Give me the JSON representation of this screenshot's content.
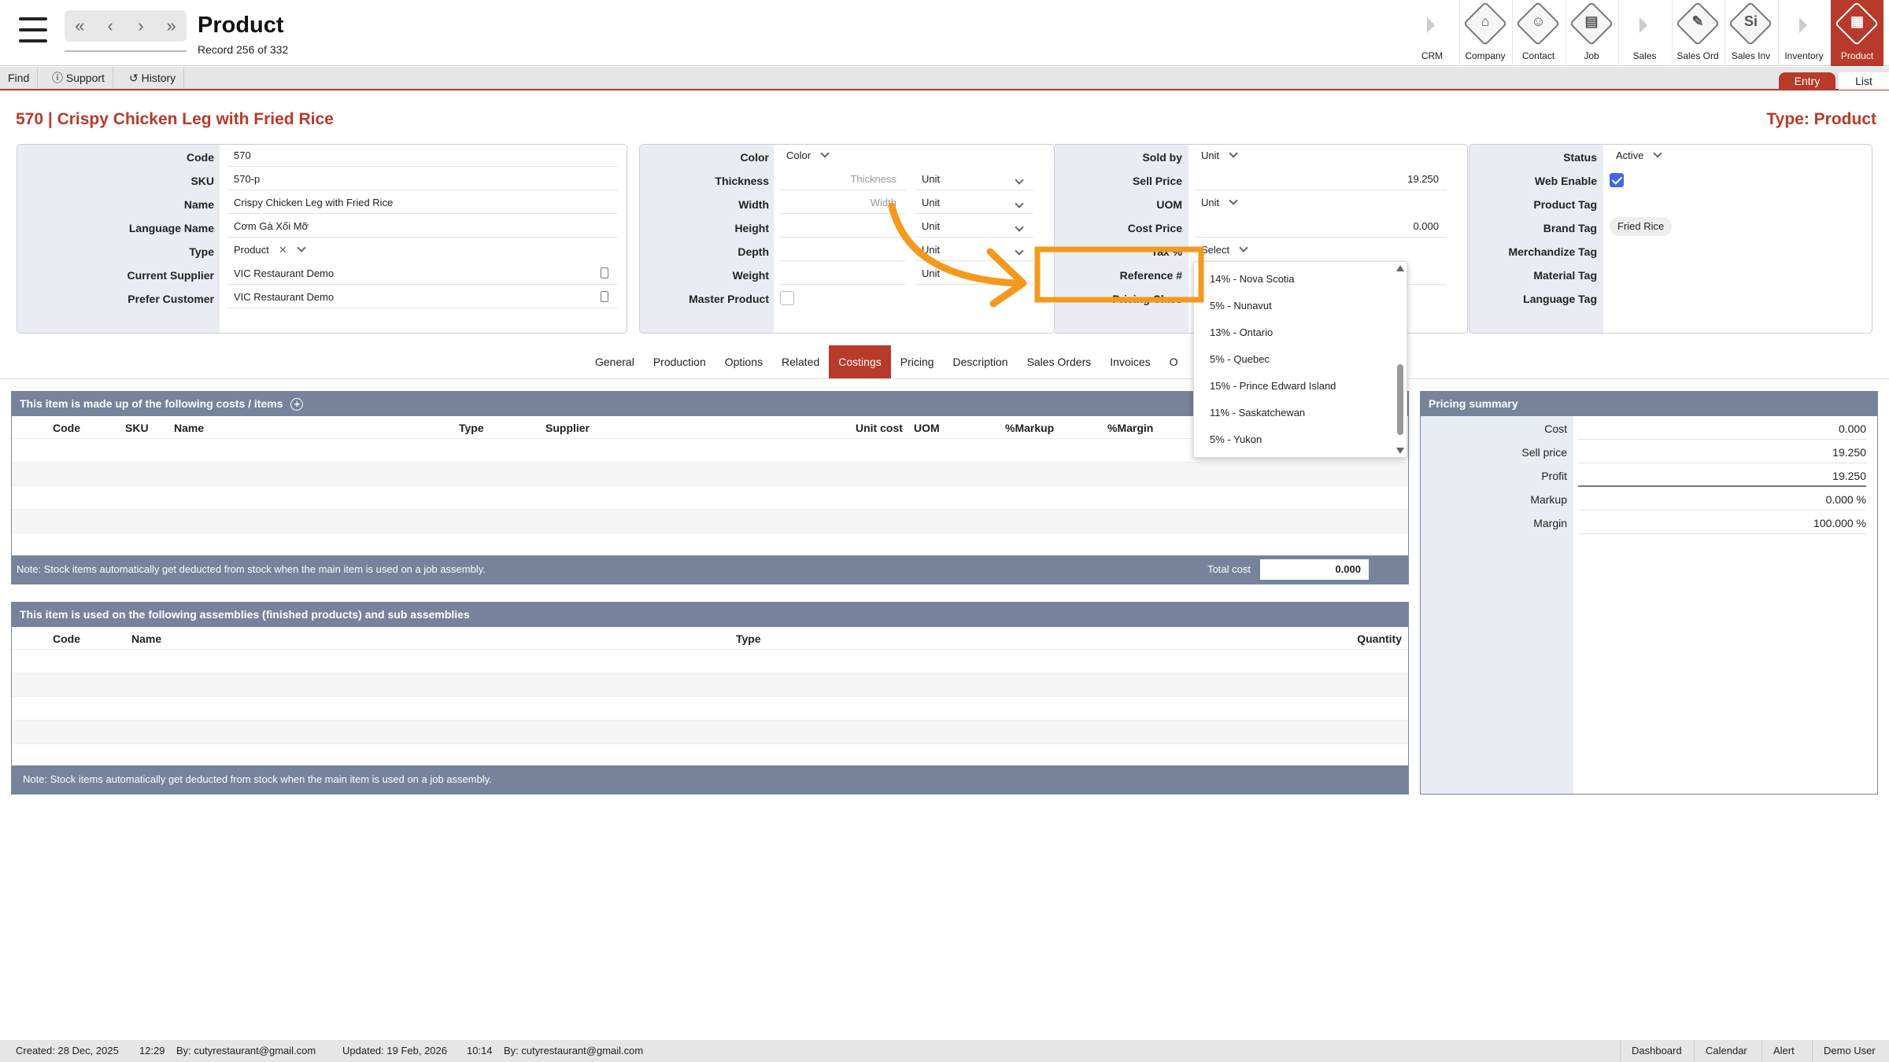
{
  "top": {
    "title": "Product",
    "record": "Record 256 of 332",
    "nav": [
      "«",
      "‹",
      "›",
      "»"
    ],
    "modules": [
      {
        "label": "CRM",
        "glyph": "",
        "kind": "arrow"
      },
      {
        "label": "Company",
        "glyph": "⌂",
        "kind": "icon"
      },
      {
        "label": "Contact",
        "glyph": "☺",
        "kind": "icon"
      },
      {
        "label": "Job",
        "glyph": "▤",
        "kind": "icon"
      },
      {
        "label": "Sales",
        "glyph": "",
        "kind": "arrow"
      },
      {
        "label": "Sales Ord",
        "glyph": "✎",
        "kind": "icon"
      },
      {
        "label": "Sales Inv",
        "glyph": "Si",
        "kind": "icon"
      },
      {
        "label": "Inventory",
        "glyph": "",
        "kind": "arrow"
      },
      {
        "label": "Product",
        "glyph": "▦",
        "kind": "icon",
        "active": true
      }
    ]
  },
  "toolbar": {
    "find": "Find",
    "support": "Support",
    "history": "History",
    "entry": "Entry",
    "list": "List"
  },
  "header": {
    "title": "570 | Crispy Chicken Leg with Fried Rice",
    "type": "Type: Product"
  },
  "panel1": {
    "code_label": "Code",
    "code": "570",
    "sku_label": "SKU",
    "sku": "570-p",
    "name_label": "Name",
    "name": "Crispy Chicken Leg with Fried Rice",
    "lang_label": "Language Name",
    "lang": "Cơm Gà Xối Mỡ",
    "type_label": "Type",
    "type": "Product",
    "supplier_label": "Current Supplier",
    "supplier": "VIC Restaurant Demo",
    "customer_label": "Prefer Customer",
    "customer": "VIC Restaurant Demo"
  },
  "panel2": {
    "color_label": "Color",
    "color": "Color",
    "thickness_label": "Thickness",
    "thickness_ph": "Thickness",
    "thickness_unit": "Unit",
    "width_label": "Width",
    "width_ph": "Width",
    "width_unit": "Unit",
    "height_label": "Height",
    "height_unit": "Unit",
    "depth_label": "Depth",
    "depth_unit": "Unit",
    "weight_label": "Weight",
    "weight_unit": "Unit",
    "master_label": "Master Product"
  },
  "panel3": {
    "soldby_label": "Sold by",
    "soldby": "Unit",
    "sell_label": "Sell Price",
    "sell": "19.250",
    "uom_label": "UOM",
    "uom": "Unit",
    "cost_label": "Cost Price",
    "cost": "0.000",
    "tax_label": "Tax %",
    "tax": "Select",
    "ref_label": "Reference #",
    "pricing_label": "Pricing Class"
  },
  "panel4": {
    "status_label": "Status",
    "status": "Active",
    "web_label": "Web Enable",
    "web_enabled": true,
    "ptag_label": "Product Tag",
    "brand_label": "Brand Tag",
    "brand": "Fried Rice",
    "merch_label": "Merchandize Tag",
    "material_label": "Material Tag",
    "langtag_label": "Language Tag"
  },
  "tabs": [
    "General",
    "Production",
    "Options",
    "Related",
    "Costings",
    "Pricing",
    "Description",
    "Sales Orders",
    "Invoices",
    "O"
  ],
  "active_tab": "Costings",
  "costs": {
    "title": "This item is made up of the following costs / items",
    "columns": [
      "Code",
      "SKU",
      "Name",
      "Type",
      "Supplier",
      "Unit cost",
      "UOM",
      "%Markup",
      "%Margin"
    ],
    "note": "Note: Stock items automatically get deducted from stock when the main item is used on a job assembly.",
    "total_label": "Total cost",
    "total": "0.000"
  },
  "assemblies": {
    "title": "This item is used on the following assemblies (finished products) and sub assemblies",
    "columns": [
      "Code",
      "Name",
      "Type",
      "Quantity"
    ],
    "note": "Note: Stock items automatically get deducted from stock when the main item is used on a job assembly."
  },
  "pricing_summary": {
    "title": "Pricing summary",
    "rows": [
      {
        "label": "Cost",
        "value": "0.000"
      },
      {
        "label": "Sell price",
        "value": "19.250"
      },
      {
        "label": "Profit",
        "value": "19.250"
      },
      {
        "label": "Markup",
        "value": "0.000 %"
      },
      {
        "label": "Margin",
        "value": "100.000 %"
      }
    ]
  },
  "tax_dropdown": [
    "14% - Nova Scotia",
    "5% - Nunavut",
    "13% - Ontario",
    "5% - Quebec",
    "15% - Prince Edward Island",
    "11% - Saskatchewan",
    "5% - Yukon"
  ],
  "annotation": {
    "color": "#f39a1e"
  },
  "statusbar": {
    "created": "Created: 28 Dec, 2025",
    "created_time": "12:29",
    "created_by": "By: cutyrestaurant@gmail.com",
    "updated": "Updated: 19 Feb, 2026",
    "updated_time": "10:14",
    "updated_by": "By: cutyrestaurant@gmail.com",
    "links": [
      "Dashboard",
      "Calendar",
      "Alert",
      "Demo User"
    ]
  },
  "colors": {
    "accent": "#b83a2a",
    "header_grey": "#76839a",
    "checkbox": "#4169e1"
  }
}
